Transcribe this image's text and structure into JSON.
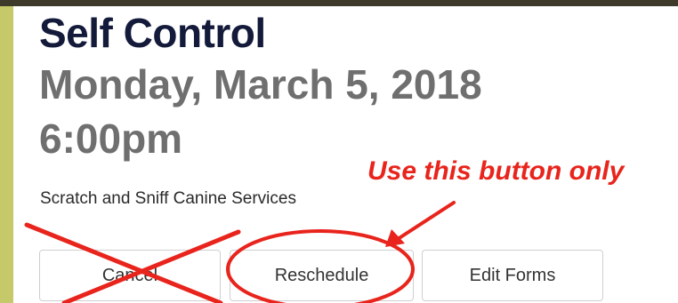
{
  "event": {
    "title": "Self Control",
    "date": "Monday, March 5, 2018",
    "time": "6:00pm",
    "provider": "Scratch and Sniff Canine Services"
  },
  "actions": {
    "cancel_label": "Cancel",
    "reschedule_label": "Reschedule",
    "edit_forms_label": "Edit Forms"
  },
  "annotation": {
    "text": "Use this button only",
    "color": "#e8241c"
  },
  "colors": {
    "title": "#131a3a",
    "subtitle": "#6f6f6f",
    "accent_bar": "#c6c96a",
    "top_bar": "#3d3a2c"
  }
}
